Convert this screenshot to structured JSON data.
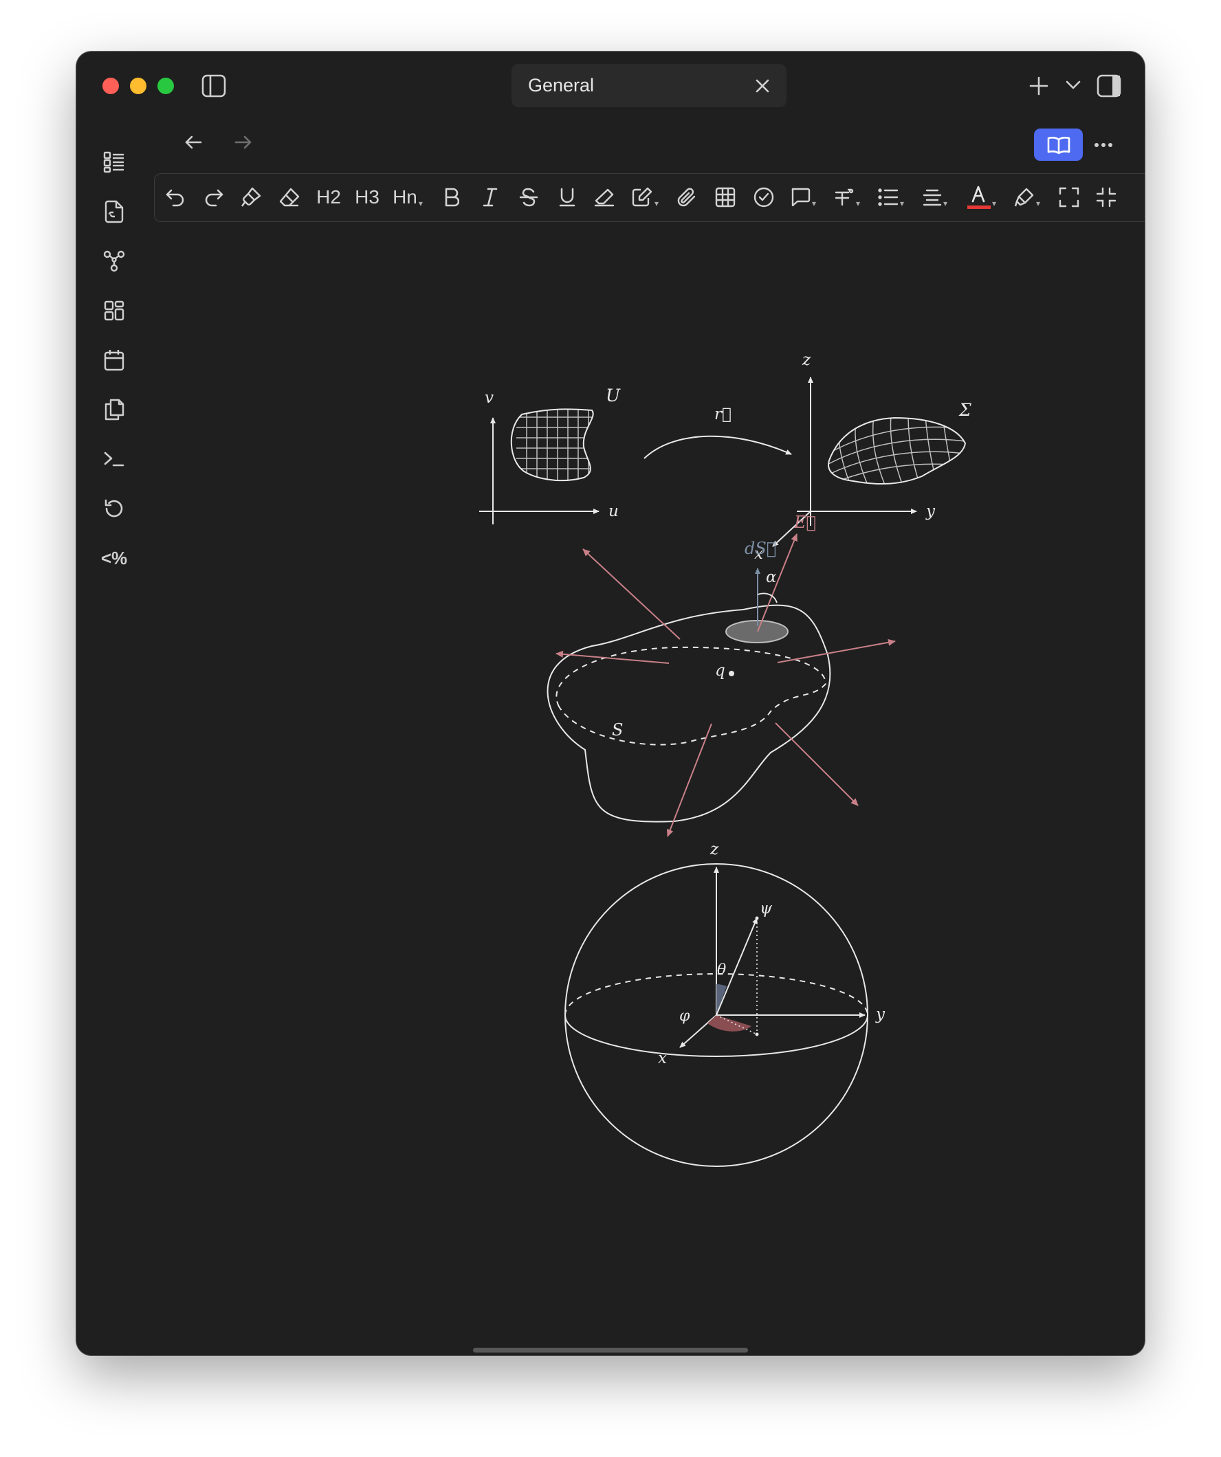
{
  "window": {
    "tab_title": "General"
  },
  "sidebar": {
    "items": [
      {
        "icon": "outline-icon"
      },
      {
        "icon": "file-link-icon"
      },
      {
        "icon": "graph-icon"
      },
      {
        "icon": "dashboard-icon"
      },
      {
        "icon": "calendar-icon"
      },
      {
        "icon": "copy-icon"
      },
      {
        "icon": "terminal-icon"
      },
      {
        "icon": "history-icon"
      },
      {
        "icon": "template-icon",
        "label": "<%"
      }
    ]
  },
  "toolbar": {
    "h2": "H2",
    "h3": "H3",
    "hn": "Hn",
    "font_color": "#e53935"
  },
  "colors": {
    "accent": "#4d6af0",
    "field_arrows": "#c98088",
    "surface_normal": "#7d8fa6"
  },
  "figures": {
    "param_map": {
      "v": "v",
      "u": "u",
      "U": "U",
      "r": "r⃗",
      "z": "z",
      "y": "y",
      "x": "x",
      "sigma": "Σ"
    },
    "gauss": {
      "E": "E⃗",
      "dS": "dS⃗",
      "alpha": "α",
      "q": "q",
      "S": "S"
    },
    "sphere": {
      "z": "z",
      "psi": "ψ",
      "theta": "θ",
      "phi": "φ",
      "y": "y",
      "x": "x"
    }
  }
}
